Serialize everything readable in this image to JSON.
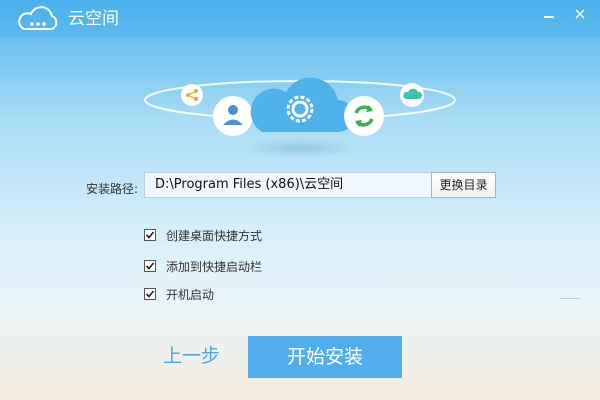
{
  "app": {
    "title": "云空间",
    "logo_icon": "cloud-logo-icon"
  },
  "titlebar": {
    "minimize_icon": "minimize-icon",
    "close_icon": "close-icon",
    "close_glyph": "×"
  },
  "hero": {
    "center_icon": "cloud-gear-icon",
    "left_icons": [
      "share-icon",
      "user-icon"
    ],
    "right_icons": [
      "sync-icon",
      "small-cloud-icon"
    ]
  },
  "install_path": {
    "label": "安装路径:",
    "value": "D:\\Program Files (x86)\\云空间",
    "browse_label": "更换目录"
  },
  "options": [
    {
      "label": "创建桌面快捷方式",
      "checked": true
    },
    {
      "label": "添加到快捷启动栏",
      "checked": true
    },
    {
      "label": "开机启动",
      "checked": true
    }
  ],
  "footer": {
    "back_label": "上一步",
    "install_label": "开始安装"
  },
  "colors": {
    "title_bar": "#4ab0ec",
    "accent": "#52adec",
    "sync_green": "#37b24d",
    "share_orange": "#f5a623",
    "user_blue": "#4a90d9",
    "small_cloud_teal": "#3cc2a8"
  }
}
